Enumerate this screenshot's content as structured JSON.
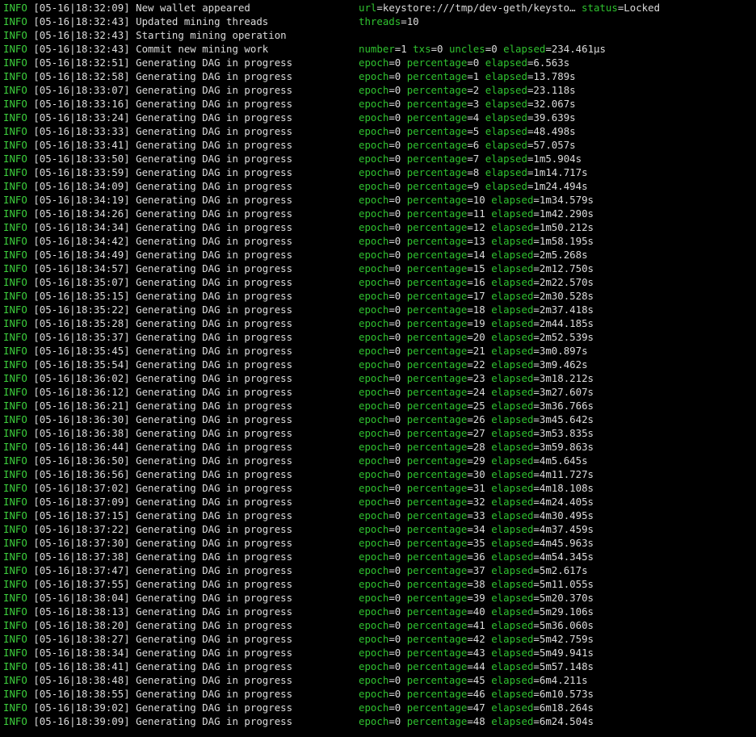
{
  "terminal": {
    "background": "#000000",
    "colors": {
      "level": "#3ccf3c",
      "key": "#2fc22f",
      "text": "#dcdcdc"
    },
    "lines": [
      {
        "level": "INFO",
        "time": "[05-16|18:32:09]",
        "msg": "New wallet appeared",
        "ctx": [
          {
            "k": "url",
            "v": "keystore:///tmp/dev-geth/keysto…"
          },
          {
            "k": "status",
            "v": "Locked"
          }
        ]
      },
      {
        "level": "INFO",
        "time": "[05-16|18:32:43]",
        "msg": "Updated mining threads",
        "ctx": [
          {
            "k": "threads",
            "v": "10"
          }
        ]
      },
      {
        "level": "INFO",
        "time": "[05-16|18:32:43]",
        "msg": "Starting mining operation",
        "ctx": []
      },
      {
        "level": "INFO",
        "time": "[05-16|18:32:43]",
        "msg": "Commit new mining work",
        "ctx": [
          {
            "k": "number",
            "v": "1"
          },
          {
            "k": "txs",
            "v": "0"
          },
          {
            "k": "uncles",
            "v": "0"
          },
          {
            "k": "elapsed",
            "v": "234.461µs"
          }
        ]
      },
      {
        "level": "INFO",
        "time": "[05-16|18:32:51]",
        "msg": "Generating DAG in progress",
        "ctx": [
          {
            "k": "epoch",
            "v": "0"
          },
          {
            "k": "percentage",
            "v": "0"
          },
          {
            "k": "elapsed",
            "v": "6.563s"
          }
        ]
      },
      {
        "level": "INFO",
        "time": "[05-16|18:32:58]",
        "msg": "Generating DAG in progress",
        "ctx": [
          {
            "k": "epoch",
            "v": "0"
          },
          {
            "k": "percentage",
            "v": "1"
          },
          {
            "k": "elapsed",
            "v": "13.789s"
          }
        ]
      },
      {
        "level": "INFO",
        "time": "[05-16|18:33:07]",
        "msg": "Generating DAG in progress",
        "ctx": [
          {
            "k": "epoch",
            "v": "0"
          },
          {
            "k": "percentage",
            "v": "2"
          },
          {
            "k": "elapsed",
            "v": "23.118s"
          }
        ]
      },
      {
        "level": "INFO",
        "time": "[05-16|18:33:16]",
        "msg": "Generating DAG in progress",
        "ctx": [
          {
            "k": "epoch",
            "v": "0"
          },
          {
            "k": "percentage",
            "v": "3"
          },
          {
            "k": "elapsed",
            "v": "32.067s"
          }
        ]
      },
      {
        "level": "INFO",
        "time": "[05-16|18:33:24]",
        "msg": "Generating DAG in progress",
        "ctx": [
          {
            "k": "epoch",
            "v": "0"
          },
          {
            "k": "percentage",
            "v": "4"
          },
          {
            "k": "elapsed",
            "v": "39.639s"
          }
        ]
      },
      {
        "level": "INFO",
        "time": "[05-16|18:33:33]",
        "msg": "Generating DAG in progress",
        "ctx": [
          {
            "k": "epoch",
            "v": "0"
          },
          {
            "k": "percentage",
            "v": "5"
          },
          {
            "k": "elapsed",
            "v": "48.498s"
          }
        ]
      },
      {
        "level": "INFO",
        "time": "[05-16|18:33:41]",
        "msg": "Generating DAG in progress",
        "ctx": [
          {
            "k": "epoch",
            "v": "0"
          },
          {
            "k": "percentage",
            "v": "6"
          },
          {
            "k": "elapsed",
            "v": "57.057s"
          }
        ]
      },
      {
        "level": "INFO",
        "time": "[05-16|18:33:50]",
        "msg": "Generating DAG in progress",
        "ctx": [
          {
            "k": "epoch",
            "v": "0"
          },
          {
            "k": "percentage",
            "v": "7"
          },
          {
            "k": "elapsed",
            "v": "1m5.904s"
          }
        ]
      },
      {
        "level": "INFO",
        "time": "[05-16|18:33:59]",
        "msg": "Generating DAG in progress",
        "ctx": [
          {
            "k": "epoch",
            "v": "0"
          },
          {
            "k": "percentage",
            "v": "8"
          },
          {
            "k": "elapsed",
            "v": "1m14.717s"
          }
        ]
      },
      {
        "level": "INFO",
        "time": "[05-16|18:34:09]",
        "msg": "Generating DAG in progress",
        "ctx": [
          {
            "k": "epoch",
            "v": "0"
          },
          {
            "k": "percentage",
            "v": "9"
          },
          {
            "k": "elapsed",
            "v": "1m24.494s"
          }
        ]
      },
      {
        "level": "INFO",
        "time": "[05-16|18:34:19]",
        "msg": "Generating DAG in progress",
        "ctx": [
          {
            "k": "epoch",
            "v": "0"
          },
          {
            "k": "percentage",
            "v": "10"
          },
          {
            "k": "elapsed",
            "v": "1m34.579s"
          }
        ]
      },
      {
        "level": "INFO",
        "time": "[05-16|18:34:26]",
        "msg": "Generating DAG in progress",
        "ctx": [
          {
            "k": "epoch",
            "v": "0"
          },
          {
            "k": "percentage",
            "v": "11"
          },
          {
            "k": "elapsed",
            "v": "1m42.290s"
          }
        ]
      },
      {
        "level": "INFO",
        "time": "[05-16|18:34:34]",
        "msg": "Generating DAG in progress",
        "ctx": [
          {
            "k": "epoch",
            "v": "0"
          },
          {
            "k": "percentage",
            "v": "12"
          },
          {
            "k": "elapsed",
            "v": "1m50.212s"
          }
        ]
      },
      {
        "level": "INFO",
        "time": "[05-16|18:34:42]",
        "msg": "Generating DAG in progress",
        "ctx": [
          {
            "k": "epoch",
            "v": "0"
          },
          {
            "k": "percentage",
            "v": "13"
          },
          {
            "k": "elapsed",
            "v": "1m58.195s"
          }
        ]
      },
      {
        "level": "INFO",
        "time": "[05-16|18:34:49]",
        "msg": "Generating DAG in progress",
        "ctx": [
          {
            "k": "epoch",
            "v": "0"
          },
          {
            "k": "percentage",
            "v": "14"
          },
          {
            "k": "elapsed",
            "v": "2m5.268s"
          }
        ]
      },
      {
        "level": "INFO",
        "time": "[05-16|18:34:57]",
        "msg": "Generating DAG in progress",
        "ctx": [
          {
            "k": "epoch",
            "v": "0"
          },
          {
            "k": "percentage",
            "v": "15"
          },
          {
            "k": "elapsed",
            "v": "2m12.750s"
          }
        ]
      },
      {
        "level": "INFO",
        "time": "[05-16|18:35:07]",
        "msg": "Generating DAG in progress",
        "ctx": [
          {
            "k": "epoch",
            "v": "0"
          },
          {
            "k": "percentage",
            "v": "16"
          },
          {
            "k": "elapsed",
            "v": "2m22.570s"
          }
        ]
      },
      {
        "level": "INFO",
        "time": "[05-16|18:35:15]",
        "msg": "Generating DAG in progress",
        "ctx": [
          {
            "k": "epoch",
            "v": "0"
          },
          {
            "k": "percentage",
            "v": "17"
          },
          {
            "k": "elapsed",
            "v": "2m30.528s"
          }
        ]
      },
      {
        "level": "INFO",
        "time": "[05-16|18:35:22]",
        "msg": "Generating DAG in progress",
        "ctx": [
          {
            "k": "epoch",
            "v": "0"
          },
          {
            "k": "percentage",
            "v": "18"
          },
          {
            "k": "elapsed",
            "v": "2m37.418s"
          }
        ]
      },
      {
        "level": "INFO",
        "time": "[05-16|18:35:28]",
        "msg": "Generating DAG in progress",
        "ctx": [
          {
            "k": "epoch",
            "v": "0"
          },
          {
            "k": "percentage",
            "v": "19"
          },
          {
            "k": "elapsed",
            "v": "2m44.185s"
          }
        ]
      },
      {
        "level": "INFO",
        "time": "[05-16|18:35:37]",
        "msg": "Generating DAG in progress",
        "ctx": [
          {
            "k": "epoch",
            "v": "0"
          },
          {
            "k": "percentage",
            "v": "20"
          },
          {
            "k": "elapsed",
            "v": "2m52.539s"
          }
        ]
      },
      {
        "level": "INFO",
        "time": "[05-16|18:35:45]",
        "msg": "Generating DAG in progress",
        "ctx": [
          {
            "k": "epoch",
            "v": "0"
          },
          {
            "k": "percentage",
            "v": "21"
          },
          {
            "k": "elapsed",
            "v": "3m0.897s"
          }
        ]
      },
      {
        "level": "INFO",
        "time": "[05-16|18:35:54]",
        "msg": "Generating DAG in progress",
        "ctx": [
          {
            "k": "epoch",
            "v": "0"
          },
          {
            "k": "percentage",
            "v": "22"
          },
          {
            "k": "elapsed",
            "v": "3m9.462s"
          }
        ]
      },
      {
        "level": "INFO",
        "time": "[05-16|18:36:02]",
        "msg": "Generating DAG in progress",
        "ctx": [
          {
            "k": "epoch",
            "v": "0"
          },
          {
            "k": "percentage",
            "v": "23"
          },
          {
            "k": "elapsed",
            "v": "3m18.212s"
          }
        ]
      },
      {
        "level": "INFO",
        "time": "[05-16|18:36:12]",
        "msg": "Generating DAG in progress",
        "ctx": [
          {
            "k": "epoch",
            "v": "0"
          },
          {
            "k": "percentage",
            "v": "24"
          },
          {
            "k": "elapsed",
            "v": "3m27.607s"
          }
        ]
      },
      {
        "level": "INFO",
        "time": "[05-16|18:36:21]",
        "msg": "Generating DAG in progress",
        "ctx": [
          {
            "k": "epoch",
            "v": "0"
          },
          {
            "k": "percentage",
            "v": "25"
          },
          {
            "k": "elapsed",
            "v": "3m36.766s"
          }
        ]
      },
      {
        "level": "INFO",
        "time": "[05-16|18:36:30]",
        "msg": "Generating DAG in progress",
        "ctx": [
          {
            "k": "epoch",
            "v": "0"
          },
          {
            "k": "percentage",
            "v": "26"
          },
          {
            "k": "elapsed",
            "v": "3m45.642s"
          }
        ]
      },
      {
        "level": "INFO",
        "time": "[05-16|18:36:38]",
        "msg": "Generating DAG in progress",
        "ctx": [
          {
            "k": "epoch",
            "v": "0"
          },
          {
            "k": "percentage",
            "v": "27"
          },
          {
            "k": "elapsed",
            "v": "3m53.835s"
          }
        ]
      },
      {
        "level": "INFO",
        "time": "[05-16|18:36:44]",
        "msg": "Generating DAG in progress",
        "ctx": [
          {
            "k": "epoch",
            "v": "0"
          },
          {
            "k": "percentage",
            "v": "28"
          },
          {
            "k": "elapsed",
            "v": "3m59.863s"
          }
        ]
      },
      {
        "level": "INFO",
        "time": "[05-16|18:36:50]",
        "msg": "Generating DAG in progress",
        "ctx": [
          {
            "k": "epoch",
            "v": "0"
          },
          {
            "k": "percentage",
            "v": "29"
          },
          {
            "k": "elapsed",
            "v": "4m5.645s"
          }
        ]
      },
      {
        "level": "INFO",
        "time": "[05-16|18:36:56]",
        "msg": "Generating DAG in progress",
        "ctx": [
          {
            "k": "epoch",
            "v": "0"
          },
          {
            "k": "percentage",
            "v": "30"
          },
          {
            "k": "elapsed",
            "v": "4m11.727s"
          }
        ]
      },
      {
        "level": "INFO",
        "time": "[05-16|18:37:02]",
        "msg": "Generating DAG in progress",
        "ctx": [
          {
            "k": "epoch",
            "v": "0"
          },
          {
            "k": "percentage",
            "v": "31"
          },
          {
            "k": "elapsed",
            "v": "4m18.108s"
          }
        ]
      },
      {
        "level": "INFO",
        "time": "[05-16|18:37:09]",
        "msg": "Generating DAG in progress",
        "ctx": [
          {
            "k": "epoch",
            "v": "0"
          },
          {
            "k": "percentage",
            "v": "32"
          },
          {
            "k": "elapsed",
            "v": "4m24.405s"
          }
        ]
      },
      {
        "level": "INFO",
        "time": "[05-16|18:37:15]",
        "msg": "Generating DAG in progress",
        "ctx": [
          {
            "k": "epoch",
            "v": "0"
          },
          {
            "k": "percentage",
            "v": "33"
          },
          {
            "k": "elapsed",
            "v": "4m30.495s"
          }
        ]
      },
      {
        "level": "INFO",
        "time": "[05-16|18:37:22]",
        "msg": "Generating DAG in progress",
        "ctx": [
          {
            "k": "epoch",
            "v": "0"
          },
          {
            "k": "percentage",
            "v": "34"
          },
          {
            "k": "elapsed",
            "v": "4m37.459s"
          }
        ]
      },
      {
        "level": "INFO",
        "time": "[05-16|18:37:30]",
        "msg": "Generating DAG in progress",
        "ctx": [
          {
            "k": "epoch",
            "v": "0"
          },
          {
            "k": "percentage",
            "v": "35"
          },
          {
            "k": "elapsed",
            "v": "4m45.963s"
          }
        ]
      },
      {
        "level": "INFO",
        "time": "[05-16|18:37:38]",
        "msg": "Generating DAG in progress",
        "ctx": [
          {
            "k": "epoch",
            "v": "0"
          },
          {
            "k": "percentage",
            "v": "36"
          },
          {
            "k": "elapsed",
            "v": "4m54.345s"
          }
        ]
      },
      {
        "level": "INFO",
        "time": "[05-16|18:37:47]",
        "msg": "Generating DAG in progress",
        "ctx": [
          {
            "k": "epoch",
            "v": "0"
          },
          {
            "k": "percentage",
            "v": "37"
          },
          {
            "k": "elapsed",
            "v": "5m2.617s"
          }
        ]
      },
      {
        "level": "INFO",
        "time": "[05-16|18:37:55]",
        "msg": "Generating DAG in progress",
        "ctx": [
          {
            "k": "epoch",
            "v": "0"
          },
          {
            "k": "percentage",
            "v": "38"
          },
          {
            "k": "elapsed",
            "v": "5m11.055s"
          }
        ]
      },
      {
        "level": "INFO",
        "time": "[05-16|18:38:04]",
        "msg": "Generating DAG in progress",
        "ctx": [
          {
            "k": "epoch",
            "v": "0"
          },
          {
            "k": "percentage",
            "v": "39"
          },
          {
            "k": "elapsed",
            "v": "5m20.370s"
          }
        ]
      },
      {
        "level": "INFO",
        "time": "[05-16|18:38:13]",
        "msg": "Generating DAG in progress",
        "ctx": [
          {
            "k": "epoch",
            "v": "0"
          },
          {
            "k": "percentage",
            "v": "40"
          },
          {
            "k": "elapsed",
            "v": "5m29.106s"
          }
        ]
      },
      {
        "level": "INFO",
        "time": "[05-16|18:38:20]",
        "msg": "Generating DAG in progress",
        "ctx": [
          {
            "k": "epoch",
            "v": "0"
          },
          {
            "k": "percentage",
            "v": "41"
          },
          {
            "k": "elapsed",
            "v": "5m36.060s"
          }
        ]
      },
      {
        "level": "INFO",
        "time": "[05-16|18:38:27]",
        "msg": "Generating DAG in progress",
        "ctx": [
          {
            "k": "epoch",
            "v": "0"
          },
          {
            "k": "percentage",
            "v": "42"
          },
          {
            "k": "elapsed",
            "v": "5m42.759s"
          }
        ]
      },
      {
        "level": "INFO",
        "time": "[05-16|18:38:34]",
        "msg": "Generating DAG in progress",
        "ctx": [
          {
            "k": "epoch",
            "v": "0"
          },
          {
            "k": "percentage",
            "v": "43"
          },
          {
            "k": "elapsed",
            "v": "5m49.941s"
          }
        ]
      },
      {
        "level": "INFO",
        "time": "[05-16|18:38:41]",
        "msg": "Generating DAG in progress",
        "ctx": [
          {
            "k": "epoch",
            "v": "0"
          },
          {
            "k": "percentage",
            "v": "44"
          },
          {
            "k": "elapsed",
            "v": "5m57.148s"
          }
        ]
      },
      {
        "level": "INFO",
        "time": "[05-16|18:38:48]",
        "msg": "Generating DAG in progress",
        "ctx": [
          {
            "k": "epoch",
            "v": "0"
          },
          {
            "k": "percentage",
            "v": "45"
          },
          {
            "k": "elapsed",
            "v": "6m4.211s"
          }
        ]
      },
      {
        "level": "INFO",
        "time": "[05-16|18:38:55]",
        "msg": "Generating DAG in progress",
        "ctx": [
          {
            "k": "epoch",
            "v": "0"
          },
          {
            "k": "percentage",
            "v": "46"
          },
          {
            "k": "elapsed",
            "v": "6m10.573s"
          }
        ]
      },
      {
        "level": "INFO",
        "time": "[05-16|18:39:02]",
        "msg": "Generating DAG in progress",
        "ctx": [
          {
            "k": "epoch",
            "v": "0"
          },
          {
            "k": "percentage",
            "v": "47"
          },
          {
            "k": "elapsed",
            "v": "6m18.264s"
          }
        ]
      },
      {
        "level": "INFO",
        "time": "[05-16|18:39:09]",
        "msg": "Generating DAG in progress",
        "ctx": [
          {
            "k": "epoch",
            "v": "0"
          },
          {
            "k": "percentage",
            "v": "48"
          },
          {
            "k": "elapsed",
            "v": "6m24.504s"
          }
        ]
      }
    ]
  }
}
